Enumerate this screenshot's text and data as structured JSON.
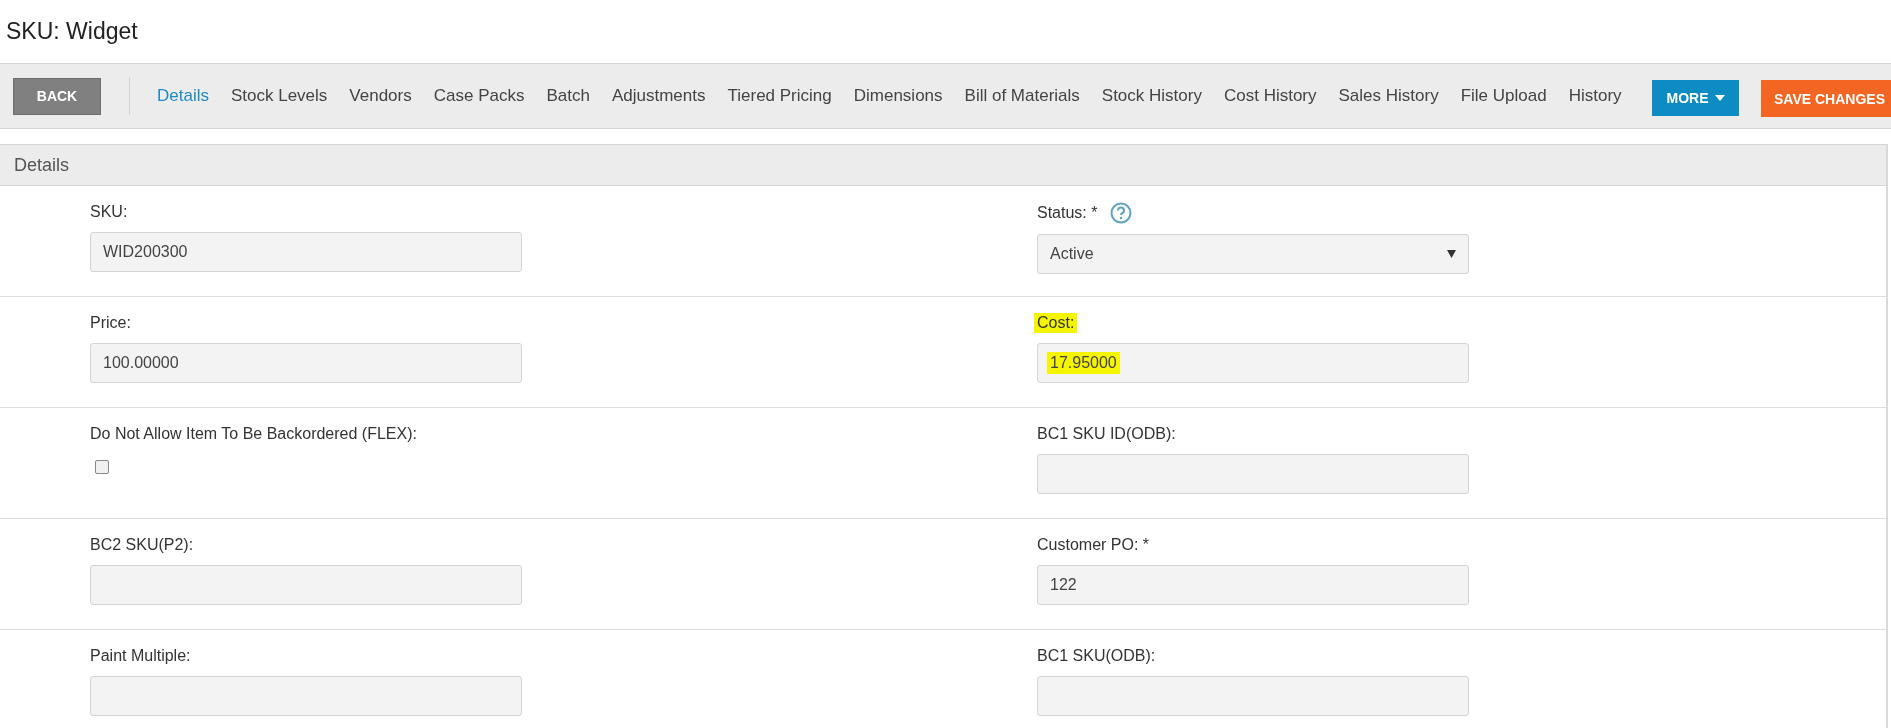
{
  "title": "SKU: Widget",
  "toolbar": {
    "back": "BACK",
    "more": "MORE",
    "save": "SAVE CHANGES",
    "tabs": [
      {
        "label": "Details",
        "selected": true
      },
      {
        "label": "Stock Levels",
        "selected": false
      },
      {
        "label": "Vendors",
        "selected": false
      },
      {
        "label": "Case Packs",
        "selected": false
      },
      {
        "label": "Batch",
        "selected": false
      },
      {
        "label": "Adjustments",
        "selected": false
      },
      {
        "label": "Tiered Pricing",
        "selected": false
      },
      {
        "label": "Dimensions",
        "selected": false
      },
      {
        "label": "Bill of Materials",
        "selected": false
      },
      {
        "label": "Stock History",
        "selected": false
      },
      {
        "label": "Cost History",
        "selected": false
      },
      {
        "label": "Sales History",
        "selected": false
      },
      {
        "label": "File Upload",
        "selected": false
      },
      {
        "label": "History",
        "selected": false
      }
    ]
  },
  "section": {
    "title": "Details",
    "rows": [
      [
        {
          "kind": "text",
          "label": "SKU:",
          "value": "WID200300",
          "highlighted": false
        },
        {
          "kind": "select",
          "label": "Status: *",
          "value": "Active",
          "help": true,
          "highlighted": false
        }
      ],
      [
        {
          "kind": "text",
          "label": "Price:",
          "value": "100.00000",
          "highlighted": false
        },
        {
          "kind": "text",
          "label": "Cost:",
          "value": "17.95000",
          "highlighted": true
        }
      ],
      [
        {
          "kind": "checkbox",
          "label": "Do Not Allow Item To Be Backordered (FLEX):",
          "checked": false
        },
        {
          "kind": "text",
          "label": "BC1 SKU ID(ODB):",
          "highlighted": false
        }
      ],
      [
        {
          "kind": "text",
          "label": "BC2 SKU(P2):",
          "highlighted": false
        },
        {
          "kind": "text",
          "label": "Customer PO: *",
          "value": "122",
          "highlighted": false
        }
      ],
      [
        {
          "kind": "text",
          "label": "Paint Multiple:",
          "highlighted": false
        },
        {
          "kind": "text",
          "label": "BC1 SKU(ODB):",
          "highlighted": false
        }
      ]
    ]
  }
}
